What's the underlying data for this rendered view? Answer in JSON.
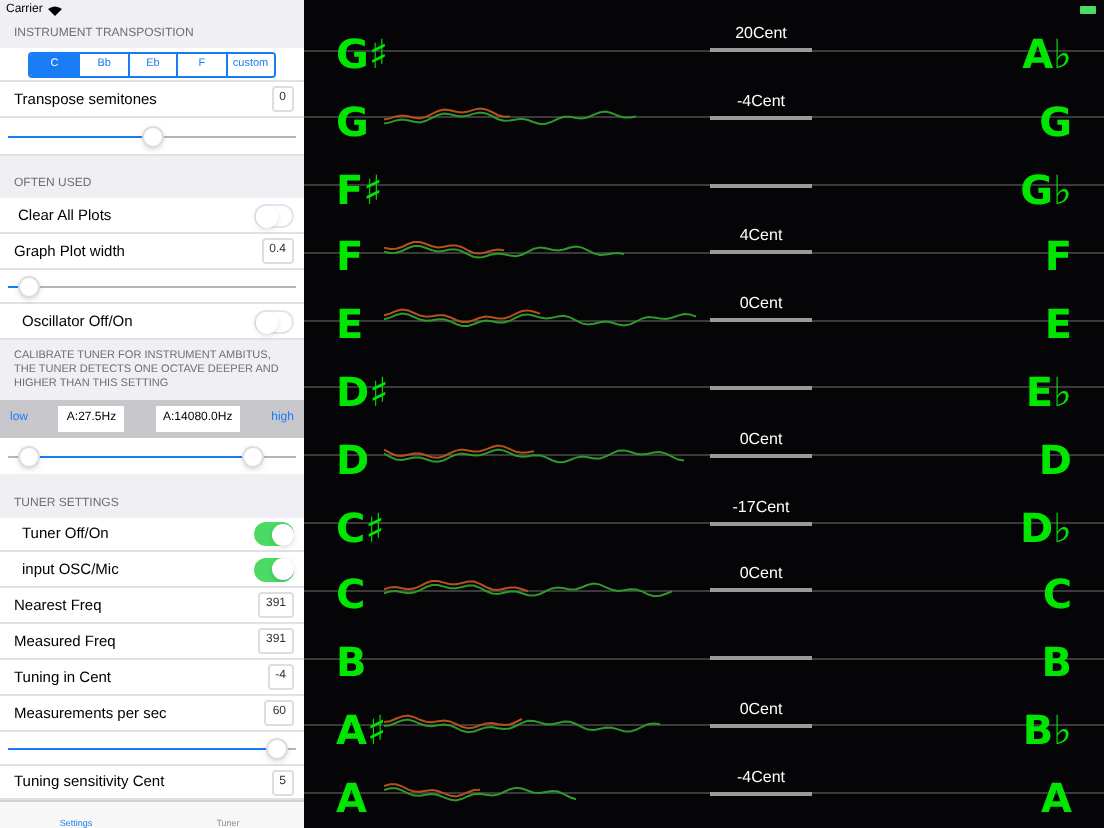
{
  "status_bar": {
    "carrier": "Carrier"
  },
  "settings": {
    "transposition": {
      "header": "INSTRUMENT TRANSPOSITION",
      "segments": [
        {
          "label": "C",
          "selected": true
        },
        {
          "label": "Bb",
          "selected": false
        },
        {
          "label": "Eb",
          "selected": false
        },
        {
          "label": "F",
          "selected": false
        },
        {
          "label": "custom",
          "selected": false
        }
      ],
      "semitones": {
        "label": "Transpose semitones",
        "value": "0"
      },
      "slider": {
        "level": 0.5
      }
    },
    "often_used": {
      "header": "OFTEN USED",
      "clear_plots": {
        "label": "Clear All Plots",
        "on": false
      },
      "plot_width": {
        "label": "Graph Plot width",
        "value": "0.4"
      },
      "slider": {
        "level": 0.04
      },
      "oscillator": {
        "label": "Oscillator Off/On",
        "on": false
      }
    },
    "calibrate": {
      "description": "CALIBRATE TUNER FOR INSTRUMENT AMBITUS, THE TUNER DETECTS ONE OCTAVE DEEPER AND HIGHER THAN THIS SETTING",
      "low_label": "low",
      "low_value": "A:27.5Hz",
      "high_value": "A:14080.0Hz",
      "high_label": "high",
      "thumbs": [
        {
          "level": 0.04
        },
        {
          "level": 0.88
        }
      ]
    },
    "tuner": {
      "header": "TUNER SETTINGS",
      "toggles": [
        {
          "label": "Tuner Off/On",
          "on": true
        },
        {
          "label": "input OSC/Mic",
          "on": true
        }
      ],
      "values": [
        {
          "label": "Nearest Freq",
          "value": "391"
        },
        {
          "label": "Measured Freq",
          "value": "391"
        },
        {
          "label": "Tuning in Cent",
          "value": "-4"
        },
        {
          "label": "Measurements per sec",
          "value": "60"
        }
      ],
      "slider": {
        "level": 0.97
      },
      "sensitivity": {
        "label": "Tuning sensitivity Cent",
        "value": "5"
      }
    }
  },
  "tab_bar": [
    {
      "label": "Settings",
      "selected": true
    },
    {
      "label": "Tuner",
      "selected": false
    }
  ],
  "tuner_rows": [
    {
      "note": "G♯",
      "cents": "20Cent",
      "alt_note": "A♭",
      "plot": false
    },
    {
      "note": "G",
      "cents": "-4Cent",
      "alt_note": "G",
      "plot": true
    },
    {
      "note": "F♯",
      "alt_note": "G♭",
      "plot": false
    },
    {
      "note": "F",
      "cents": "4Cent",
      "alt_note": "F",
      "plot": true
    },
    {
      "note": "E",
      "cents": "0Cent",
      "alt_note": "E",
      "plot": true
    },
    {
      "note": "D♯",
      "alt_note": "E♭",
      "plot": false
    },
    {
      "note": "D",
      "cents": "0Cent",
      "alt_note": "D",
      "plot": true
    },
    {
      "note": "C♯",
      "cents": "-17Cent",
      "alt_note": "D♭",
      "plot": false
    },
    {
      "note": "C",
      "cents": "0Cent",
      "alt_note": "C",
      "plot": true
    },
    {
      "note": "B",
      "alt_note": "B",
      "plot": false
    },
    {
      "note": "A♯",
      "cents": "0Cent",
      "alt_note": "B♭",
      "plot": true
    },
    {
      "note": "A",
      "cents": "-4Cent",
      "alt_note": "A",
      "plot": true
    }
  ]
}
